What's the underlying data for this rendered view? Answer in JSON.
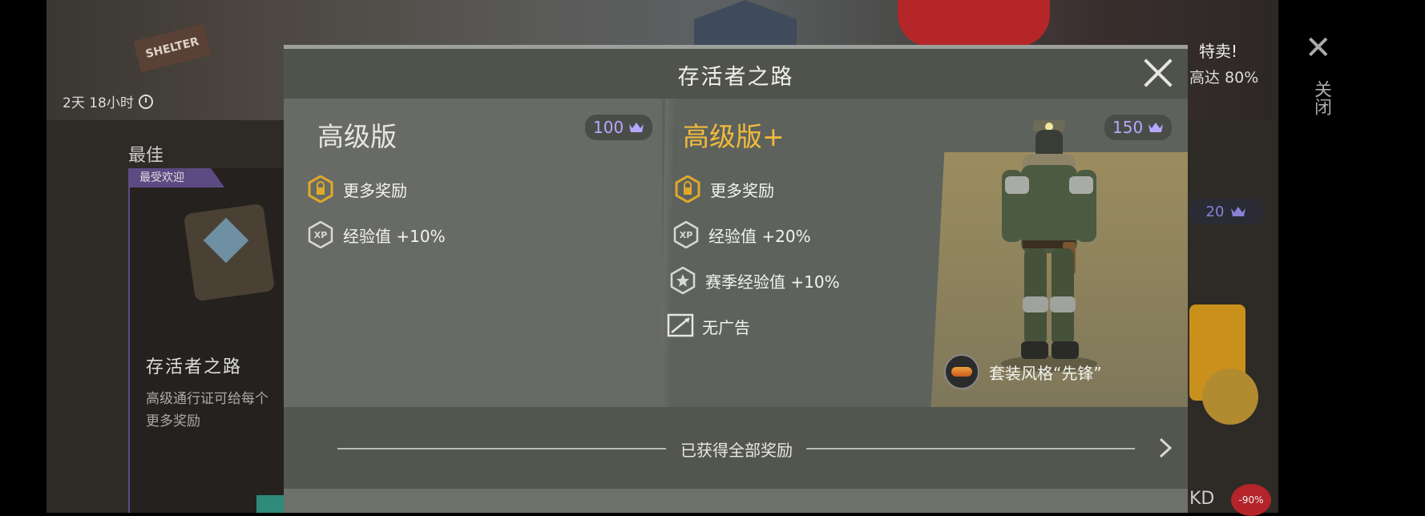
{
  "background": {
    "timer_text": "2天 18小时",
    "sign_text": "SHELTER",
    "best_label": "最佳",
    "popular_badge": "最受欢迎",
    "card_title": "存活者之路",
    "card_desc": "高级通行证可给每个\n更多奖励",
    "right_sale": "特卖!",
    "right_upto": "高达 80%",
    "close_label": "关闭",
    "price_20": "20",
    "kd_text": "KD",
    "discount_badge": "-90%"
  },
  "modal": {
    "title": "存活者之路",
    "tiers": [
      {
        "name": "高级版",
        "price": "100",
        "features": [
          {
            "icon": "lock-icon",
            "label": "更多奖励"
          },
          {
            "icon": "xp-icon",
            "label": "经验值 +10%"
          }
        ]
      },
      {
        "name": "高级版+",
        "price": "150",
        "features": [
          {
            "icon": "lock-icon",
            "label": "更多奖励"
          },
          {
            "icon": "xp-icon",
            "label": "经验值 +20%"
          },
          {
            "icon": "season-xp-icon",
            "label": "赛季经验值 +10%"
          },
          {
            "icon": "no-ads-icon",
            "label": "无广告"
          }
        ],
        "outfit_label": "套装风格“先锋”"
      }
    ],
    "footer_text": "已获得全部奖励"
  },
  "colors": {
    "accent_gold": "#f2bb3a",
    "crown_purple": "#b5a8ff",
    "modal_bg": "#6b6e67",
    "header_bg": "#50534c"
  }
}
